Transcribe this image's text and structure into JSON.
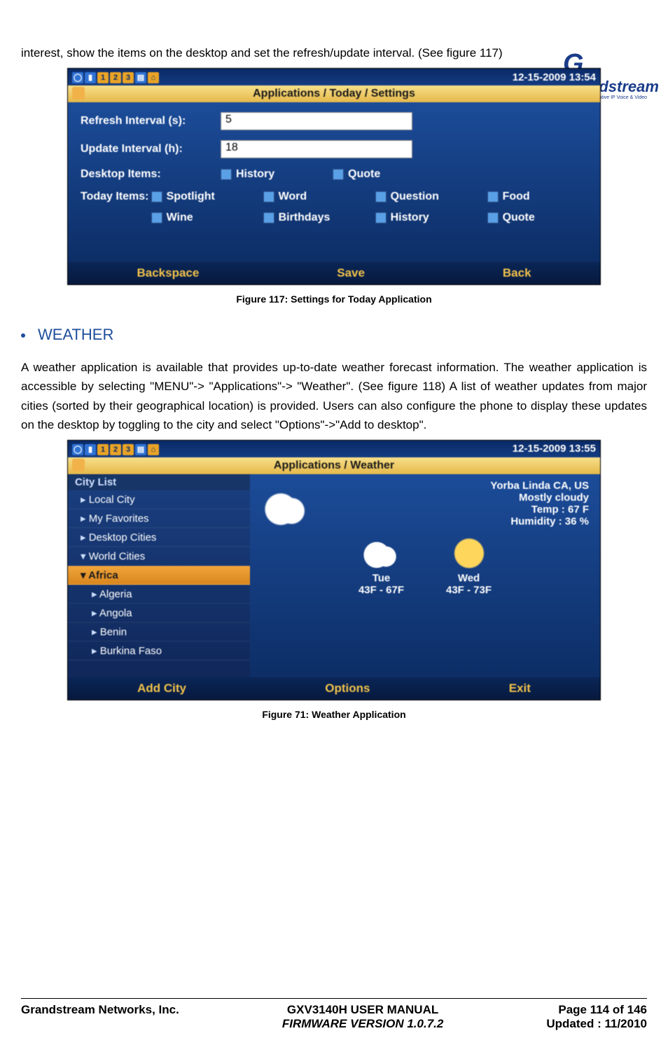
{
  "logo": {
    "brand": "Grandstream",
    "tag": "Innovative IP Voice & Video"
  },
  "intro_text": "interest, show the items on the desktop and set the refresh/update interval. (See figure 117)",
  "fig117": {
    "status_date": "12-15-2009 13:54",
    "title": "Applications / Today / Settings",
    "rows": {
      "refresh_lbl": "Refresh Interval (s):",
      "refresh_val": "5",
      "update_lbl": "Update Interval (h):",
      "update_val": "18",
      "desktop_lbl": "Desktop Items:",
      "today_lbl": "Today Items:"
    },
    "desktop_items": [
      "History",
      "Quote"
    ],
    "today_items": [
      "Spotlight",
      "Word",
      "Question",
      "Food",
      "Wine",
      "Birthdays",
      "History",
      "Quote"
    ],
    "softkeys": [
      "Backspace",
      "Save",
      "Back"
    ],
    "caption": "Figure 117: Settings for Today Application"
  },
  "section": {
    "title": "WEATHER"
  },
  "weather_para": "A weather application is available that provides up-to-date weather forecast information. The weather application is accessible by selecting \"MENU\"-> \"Applications\"-> \"Weather\". (See figure 118) A list of weather updates from major cities (sorted by their geographical location) is provided. Users can also configure the phone to display these updates on the desktop by toggling to the city and select \"Options\"->\"Add to desktop\".",
  "fig71": {
    "status_date": "12-15-2009 13:55",
    "title": "Applications / Weather",
    "list_header": "City List",
    "list": [
      {
        "label": "Local City",
        "type": "col"
      },
      {
        "label": "My Favorites",
        "type": "col"
      },
      {
        "label": "Desktop Cities",
        "type": "col"
      },
      {
        "label": "World Cities",
        "type": "exp"
      },
      {
        "label": "Africa",
        "type": "sel"
      },
      {
        "label": "Algeria",
        "type": "sub"
      },
      {
        "label": "Angola",
        "type": "sub"
      },
      {
        "label": "Benin",
        "type": "sub"
      },
      {
        "label": "Burkina Faso",
        "type": "sub"
      }
    ],
    "current": {
      "city": "Yorba Linda CA, US",
      "cond": "Mostly cloudy",
      "temp": "Temp : 67 F",
      "hum": "Humidity : 36 %"
    },
    "forecast": [
      {
        "day": "Tue",
        "range": "43F - 67F",
        "icon": "cloud"
      },
      {
        "day": "Wed",
        "range": "43F - 73F",
        "icon": "sun"
      }
    ],
    "softkeys": [
      "Add City",
      "Options",
      "Exit"
    ],
    "caption": "Figure 71: Weather Application"
  },
  "footer": {
    "left": "Grandstream Networks, Inc.",
    "center1": "GXV3140H USER MANUAL",
    "center2": "FIRMWARE VERSION 1.0.7.2",
    "right1": "Page 114 of 146",
    "right2": "Updated : 11/2010"
  }
}
